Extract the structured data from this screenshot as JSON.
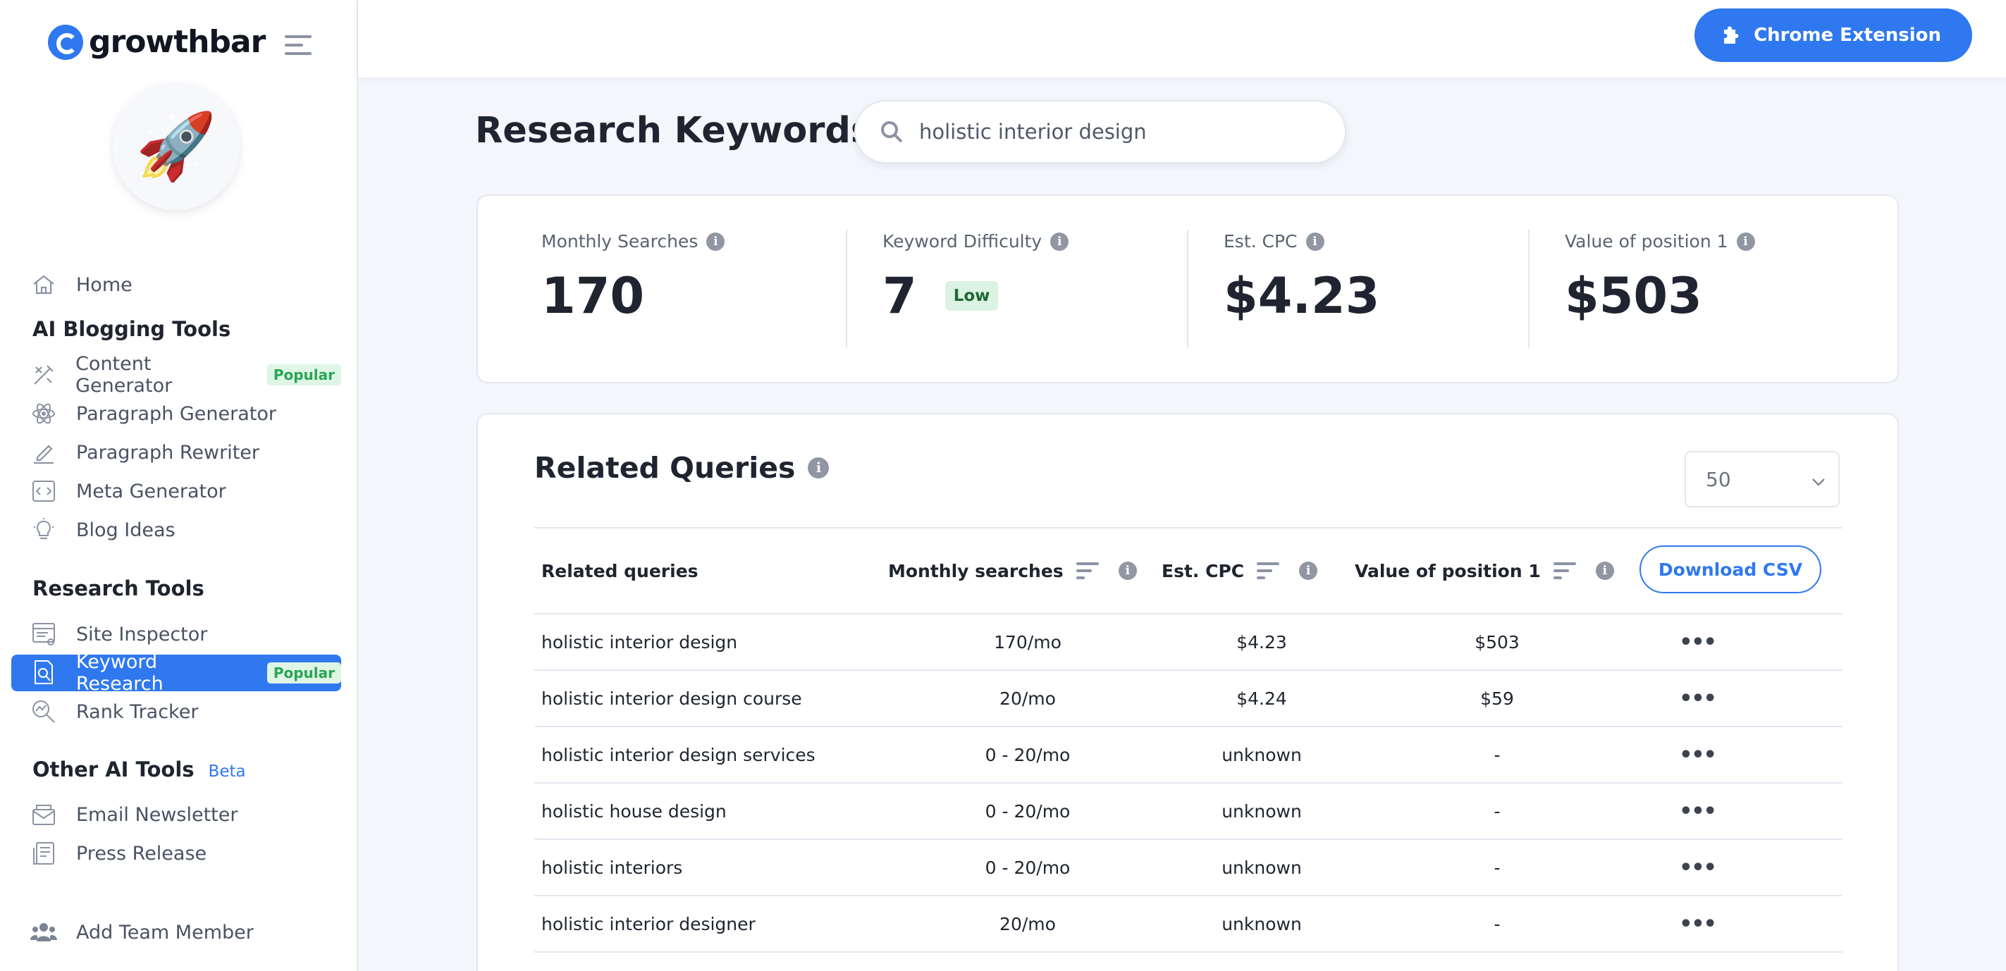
{
  "brand": {
    "name": "growthbar",
    "accent": "#2f78f0"
  },
  "avatar": {
    "emoji": "🚀"
  },
  "sidebar": {
    "home": {
      "label": "Home",
      "icon": "home-icon"
    },
    "ai_section": "AI Blogging Tools",
    "ai_items": [
      {
        "label": "Content Generator",
        "icon": "magic-wand-icon",
        "badge": "Popular"
      },
      {
        "label": "Paragraph Generator",
        "icon": "atom-icon"
      },
      {
        "label": "Paragraph Rewriter",
        "icon": "pen-icon"
      },
      {
        "label": "Meta Generator",
        "icon": "code-icon"
      },
      {
        "label": "Blog Ideas",
        "icon": "lightbulb-icon"
      }
    ],
    "research_section": "Research Tools",
    "research_items": [
      {
        "label": "Site Inspector",
        "icon": "site-icon"
      },
      {
        "label": "Keyword Research",
        "icon": "keyword-search-icon",
        "badge": "Popular",
        "active": true
      },
      {
        "label": "Rank Tracker",
        "icon": "chart-search-icon"
      }
    ],
    "other_section": "Other AI Tools",
    "other_badge": "Beta",
    "other_items": [
      {
        "label": "Email Newsletter",
        "icon": "envelope-icon"
      },
      {
        "label": "Press Release",
        "icon": "press-icon"
      }
    ],
    "add_team": {
      "label": "Add Team Member",
      "icon": "team-icon"
    }
  },
  "topbar": {
    "chrome_button": "Chrome Extension"
  },
  "main": {
    "title": "Research Keywords",
    "search": {
      "value": "holistic interior design",
      "placeholder": ""
    }
  },
  "stats": [
    {
      "label": "Monthly Searches",
      "value": "170"
    },
    {
      "label": "Keyword Difficulty",
      "value": "7",
      "badge": "Low"
    },
    {
      "label": "Est. CPC",
      "value": "$4.23"
    },
    {
      "label": "Value of position 1",
      "value": "$503"
    }
  ],
  "related": {
    "title": "Related Queries",
    "per_page": "50",
    "columns": [
      "Related queries",
      "Monthly searches",
      "Est. CPC",
      "Value of position 1"
    ],
    "download_label": "Download CSV",
    "rows": [
      {
        "query": "holistic interior design",
        "monthly": "170/mo",
        "cpc": "$4.23",
        "value": "$503"
      },
      {
        "query": "holistic interior design course",
        "monthly": "20/mo",
        "cpc": "$4.24",
        "value": "$59"
      },
      {
        "query": "holistic interior design services",
        "monthly": "0 - 20/mo",
        "cpc": "unknown",
        "value": "-"
      },
      {
        "query": "holistic house design",
        "monthly": "0 - 20/mo",
        "cpc": "unknown",
        "value": "-"
      },
      {
        "query": "holistic interiors",
        "monthly": "0 - 20/mo",
        "cpc": "unknown",
        "value": "-"
      },
      {
        "query": "holistic interior designer",
        "monthly": "20/mo",
        "cpc": "unknown",
        "value": "-"
      }
    ]
  }
}
